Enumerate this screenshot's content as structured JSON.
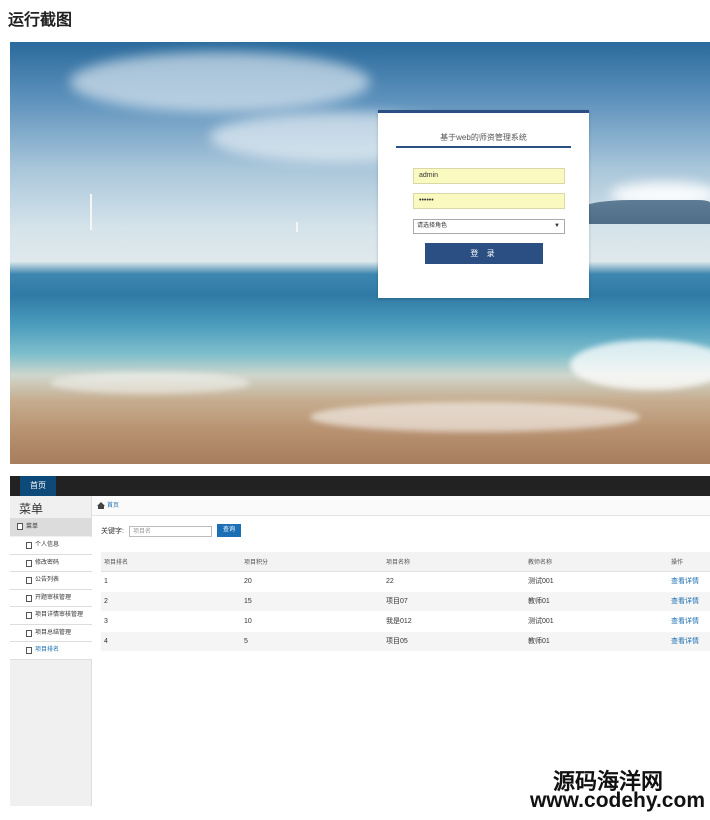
{
  "doc": {
    "title": "运行截图"
  },
  "login": {
    "title": "基于web的师资管理系统",
    "username_value": "admin",
    "password_value": "••••••",
    "role_placeholder": "请选择角色",
    "login_button": "登 录"
  },
  "admin": {
    "nav": {
      "home_tab": "首页"
    },
    "sidebar": {
      "heading": "菜单",
      "group": "菜单",
      "items": [
        {
          "label": "个人信息",
          "active": false
        },
        {
          "label": "修改密码",
          "active": false
        },
        {
          "label": "公告列表",
          "active": false
        },
        {
          "label": "开题审核管理",
          "active": false
        },
        {
          "label": "项目详情审核管理",
          "active": false
        },
        {
          "label": "项目总结管理",
          "active": false
        },
        {
          "label": "项目排名",
          "active": true
        }
      ]
    },
    "breadcrumb": "首页",
    "search": {
      "label": "关键字:",
      "placeholder": "项目名",
      "button": "查询"
    },
    "table": {
      "columns": [
        "项目排名",
        "项目积分",
        "项目名称",
        "教师名称",
        "操作"
      ],
      "rows": [
        [
          "1",
          "20",
          "22",
          "测试001",
          "查看详情"
        ],
        [
          "2",
          "15",
          "项目07",
          "教师01",
          "查看详情"
        ],
        [
          "3",
          "10",
          "我是012",
          "测试001",
          "查看详情"
        ],
        [
          "4",
          "5",
          "项目05",
          "教师01",
          "查看详情"
        ]
      ]
    }
  },
  "watermark": {
    "cn": "源码海洋网",
    "url": "www.codehy.com"
  }
}
